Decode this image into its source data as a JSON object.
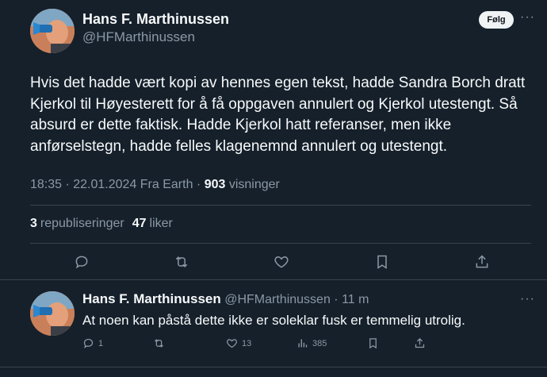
{
  "tweet": {
    "author_name": "Hans F. Marthinussen",
    "author_handle": "@HFMarthinussen",
    "follow_label": "Følg",
    "text": "Hvis det hadde vært kopi av hennes egen tekst, hadde Sandra Borch dratt Kjerkol til Høyesterett for å få oppgaven annulert og Kjerkol utestengt. Så absurd er dette faktisk. Hadde Kjerkol hatt referanser, men ikke anførselstegn, hadde felles klagenemnd annulert og utestengt.",
    "time_date": "18:35 · 22.01.2024 Fra Earth · ",
    "views_count": "903",
    "views_label": " visninger",
    "reposts_count": "3",
    "reposts_label": "republiseringer",
    "likes_count": "47",
    "likes_label": "liker"
  },
  "reply": {
    "author_name": "Hans F. Marthinussen",
    "author_handle": "@HFMarthinussen",
    "time": " · 11 m",
    "text": "At noen kan påstå dette ikke er soleklar fusk er temmelig utrolig.",
    "reply_count": "1",
    "like_count": "13",
    "views_count": "385"
  },
  "icons": {
    "reply": "reply-icon",
    "repost": "repost-icon",
    "like": "heart-icon",
    "bookmark": "bookmark-icon",
    "share": "share-icon",
    "views": "views-icon",
    "more": "more-icon"
  },
  "colors": {
    "background": "#15202b",
    "text": "#f7f9f9",
    "secondary": "#8b98a5",
    "divider": "#38444d",
    "follow_bg": "#eff3f4"
  }
}
